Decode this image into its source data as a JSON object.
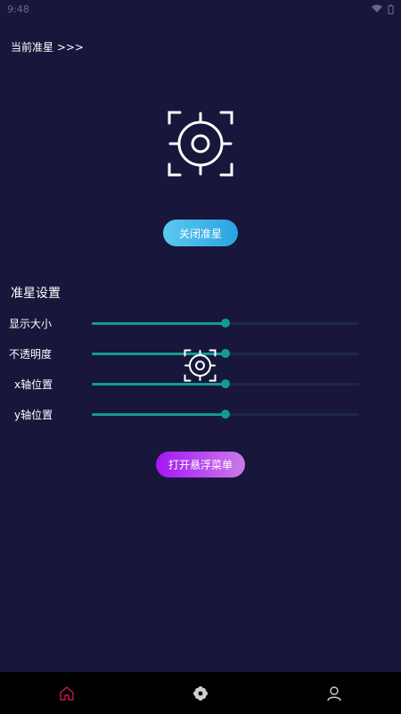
{
  "status_bar": {
    "time": "9:48"
  },
  "header": {
    "current_label": "当前准星 >>>"
  },
  "preview": {
    "icon": "crosshair-icon"
  },
  "toggle_button": {
    "label": "关闭准星"
  },
  "settings": {
    "title": "准星设置",
    "sliders": [
      {
        "label": "显示大小",
        "value": 0.5
      },
      {
        "label": "不透明度",
        "value": 0.5
      },
      {
        "label": "x轴位置",
        "value": 0.5
      },
      {
        "label": "y轴位置",
        "value": 0.5
      }
    ]
  },
  "floating_menu_button": {
    "label": "打开悬浮菜单"
  },
  "bottom_nav": {
    "items": [
      {
        "icon": "home-icon",
        "active": true
      },
      {
        "icon": "flower-icon",
        "active": false
      },
      {
        "icon": "user-icon",
        "active": false
      }
    ]
  },
  "colors": {
    "background": "#18163b",
    "slider_accent": "#139a93",
    "toggle_gradient": [
      "#5cc8ee",
      "#2aa3e4"
    ],
    "menu_gradient": [
      "#a316f4",
      "#cc7be8"
    ],
    "nav_active": "#c2185b",
    "nav_inactive": "#cfcfcf"
  }
}
